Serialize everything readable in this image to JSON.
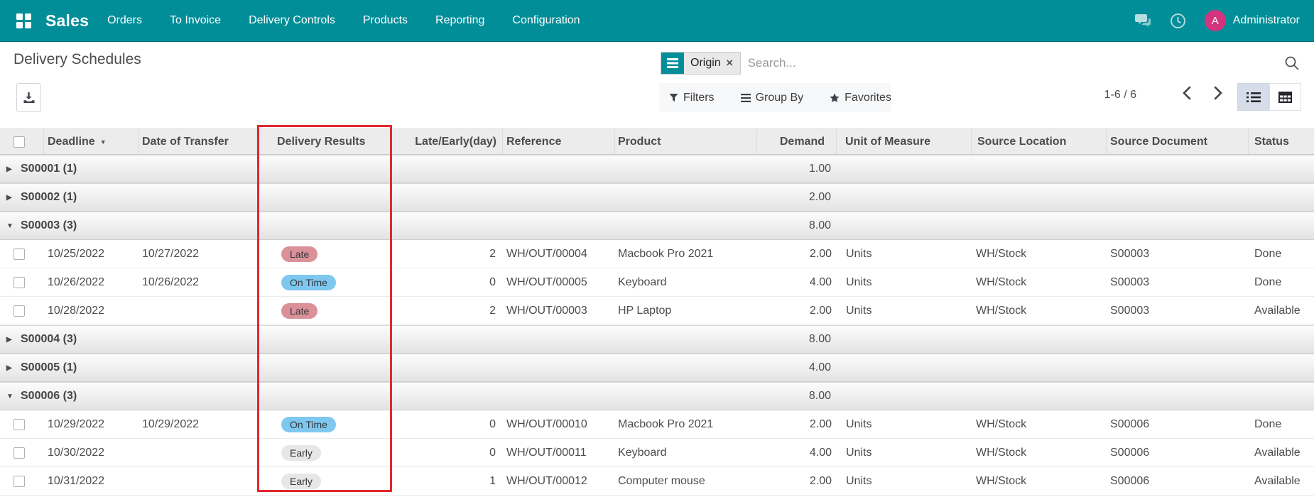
{
  "colors": {
    "navbar_bg": "#018e98",
    "accent_teal": "#018e98",
    "avatar_bg": "#d4347f",
    "badge_late_bg": "#db9199",
    "badge_ontime_bg": "#7ec8f0",
    "badge_early_bg": "#e7e7e7",
    "badge_text": "#32373c",
    "highlight_red": "#e0282e"
  },
  "nav": {
    "app_name": "Sales",
    "items": [
      {
        "label": "Orders"
      },
      {
        "label": "To Invoice"
      },
      {
        "label": "Delivery Controls"
      },
      {
        "label": "Products"
      },
      {
        "label": "Reporting"
      },
      {
        "label": "Configuration"
      }
    ],
    "user_name": "Administrator",
    "avatar_initial": "A"
  },
  "control_panel": {
    "breadcrumb": "Delivery Schedules",
    "search": {
      "facet_label": "Origin",
      "facet_remove": "✕",
      "placeholder": "Search..."
    },
    "filter_buttons": {
      "filters": "Filters",
      "group_by": "Group By",
      "favorites": "Favorites"
    },
    "pager": {
      "text": "1-6 / 6"
    }
  },
  "table": {
    "columns": [
      {
        "label": "",
        "key": "select"
      },
      {
        "label": "Deadline",
        "key": "deadline",
        "sorted": "desc"
      },
      {
        "label": "Date of Transfer",
        "key": "transfer_date"
      },
      {
        "label": "Delivery Results",
        "key": "delivery_results"
      },
      {
        "label": "Late/Early(day)",
        "key": "late_early",
        "align": "right"
      },
      {
        "label": "Reference",
        "key": "reference"
      },
      {
        "label": "Product",
        "key": "product"
      },
      {
        "label": "Demand",
        "key": "demand",
        "align": "right"
      },
      {
        "label": "Unit of Measure",
        "key": "uom"
      },
      {
        "label": "Source Location",
        "key": "source_location"
      },
      {
        "label": "Source Document",
        "key": "source_document"
      },
      {
        "label": "Status",
        "key": "status"
      }
    ],
    "rows": [
      {
        "type": "group",
        "label": "S00001 (1)",
        "expanded": false,
        "demand": "1.00"
      },
      {
        "type": "group",
        "label": "S00002 (1)",
        "expanded": false,
        "demand": "2.00"
      },
      {
        "type": "group",
        "label": "S00003 (3)",
        "expanded": true,
        "demand": "8.00"
      },
      {
        "type": "record",
        "deadline": "10/25/2022",
        "transfer_date": "10/27/2022",
        "result": "Late",
        "late_early": "2",
        "reference": "WH/OUT/00004",
        "product": "Macbook Pro 2021",
        "demand": "2.00",
        "uom": "Units",
        "source_location": "WH/Stock",
        "source_document": "S00003",
        "status": "Done"
      },
      {
        "type": "record",
        "deadline": "10/26/2022",
        "transfer_date": "10/26/2022",
        "result": "On Time",
        "late_early": "0",
        "reference": "WH/OUT/00005",
        "product": "Keyboard",
        "demand": "4.00",
        "uom": "Units",
        "source_location": "WH/Stock",
        "source_document": "S00003",
        "status": "Done"
      },
      {
        "type": "record",
        "deadline": "10/28/2022",
        "transfer_date": "",
        "result": "Late",
        "late_early": "2",
        "reference": "WH/OUT/00003",
        "product": "HP Laptop",
        "demand": "2.00",
        "uom": "Units",
        "source_location": "WH/Stock",
        "source_document": "S00003",
        "status": "Available"
      },
      {
        "type": "group",
        "label": "S00004 (3)",
        "expanded": false,
        "demand": "8.00"
      },
      {
        "type": "group",
        "label": "S00005 (1)",
        "expanded": false,
        "demand": "4.00"
      },
      {
        "type": "group",
        "label": "S00006 (3)",
        "expanded": true,
        "demand": "8.00"
      },
      {
        "type": "record",
        "deadline": "10/29/2022",
        "transfer_date": "10/29/2022",
        "result": "On Time",
        "late_early": "0",
        "reference": "WH/OUT/00010",
        "product": "Macbook Pro 2021",
        "demand": "2.00",
        "uom": "Units",
        "source_location": "WH/Stock",
        "source_document": "S00006",
        "status": "Done"
      },
      {
        "type": "record",
        "deadline": "10/30/2022",
        "transfer_date": "",
        "result": "Early",
        "late_early": "0",
        "reference": "WH/OUT/00011",
        "product": "Keyboard",
        "demand": "4.00",
        "uom": "Units",
        "source_location": "WH/Stock",
        "source_document": "S00006",
        "status": "Available"
      },
      {
        "type": "record",
        "deadline": "10/31/2022",
        "transfer_date": "",
        "result": "Early",
        "late_early": "1",
        "reference": "WH/OUT/00012",
        "product": "Computer mouse",
        "demand": "2.00",
        "uom": "Units",
        "source_location": "WH/Stock",
        "source_document": "S00006",
        "status": "Available"
      }
    ]
  },
  "annotation": {
    "highlighted_column": "Delivery Results"
  }
}
